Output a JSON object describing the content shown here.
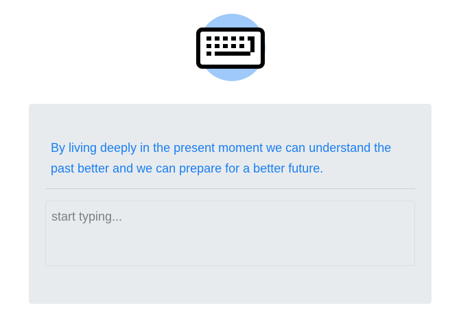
{
  "logo": {
    "icon": "keyboard-icon",
    "circle_color": "#9ec9f8",
    "icon_color": "#000000"
  },
  "quote": {
    "text": "By living deeply in the present moment we can understand the past better and we can prepare for a better future.",
    "color": "#1a7ff0"
  },
  "typing": {
    "value": "",
    "placeholder": "start typing..."
  },
  "colors": {
    "card_background": "#e8ebee",
    "divider": "#cdd1d5"
  }
}
